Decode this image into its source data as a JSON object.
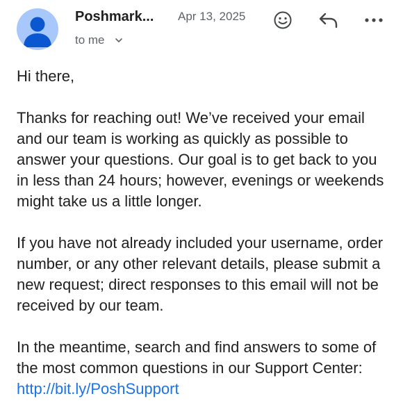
{
  "email": {
    "sender_name": "Poshmark...",
    "date": "Apr 13, 2025",
    "recipient_label": "to me",
    "icons": {
      "avatar": "person-avatar",
      "emoji": "emoji-reaction-icon",
      "reply": "reply-icon",
      "more": "more-options-icon",
      "chevron": "chevron-down-icon"
    },
    "body": {
      "greeting": "Hi there,",
      "paragraph_1": "Thanks for reaching out! We’ve received your email and our team is working as quickly as possible to answer your questions. Our goal is to get back to you in less than 24 hours; however, evenings or weekends might take us a little longer.",
      "paragraph_2": "If you have not already included your username, order number, or any other relevant details, please submit a new request; direct responses to this email will not be received by our team.",
      "paragraph_3_text": "In the meantime, search and find answers to some of the most common questions in our Support Center: ",
      "paragraph_3_link": "http://bit.ly/PoshSupport"
    }
  },
  "colors": {
    "avatar_bg": "#a8c7fa",
    "avatar_figure": "#0b57d0",
    "link": "#1a73e8",
    "secondary_text": "#5f6368"
  }
}
